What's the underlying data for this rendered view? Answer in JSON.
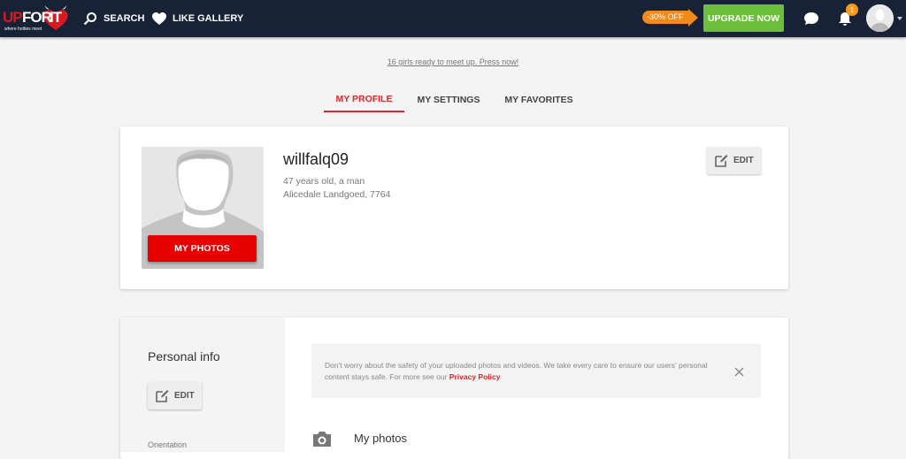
{
  "header": {
    "logo": {
      "part1": "UP",
      "part2": "FOR",
      "part3": "IT",
      "tagline": "where hotties meet"
    },
    "nav": [
      {
        "label": "SEARCH",
        "icon": "search-icon"
      },
      {
        "label": "LIKE GALLERY",
        "icon": "heart-icon"
      }
    ],
    "promo_tag": "-30% OFF",
    "upgrade_label": "UPGRADE NOW",
    "notifications_count": "1",
    "colors": {
      "bar": "#172236",
      "upgrade": "#6cbf3a",
      "promo": "#f08a1c",
      "accent": "#e0262a"
    }
  },
  "promo_link": "16 girls ready to meet up. Press now!",
  "tabs": [
    {
      "label": "MY PROFILE",
      "active": true
    },
    {
      "label": "MY SETTINGS",
      "active": false
    },
    {
      "label": "MY FAVORITES",
      "active": false
    }
  ],
  "profile": {
    "username": "willfalq09",
    "age_gender": "47 years old, a man",
    "location": "Alicedale Landgoed, 7764",
    "my_photos_label": "MY PHOTOS",
    "edit_label": "EDIT"
  },
  "personal_info": {
    "title": "Personal info",
    "edit_label": "EDIT",
    "fields": [
      {
        "label": "Orientation"
      }
    ]
  },
  "notice": {
    "text": "Don't worry about the safety of your uploaded photos and videos. We take every care to ensure our users' personal content stays safe. For more see our ",
    "link": "Privacy Policy"
  },
  "photos_section": {
    "title": "My photos"
  }
}
